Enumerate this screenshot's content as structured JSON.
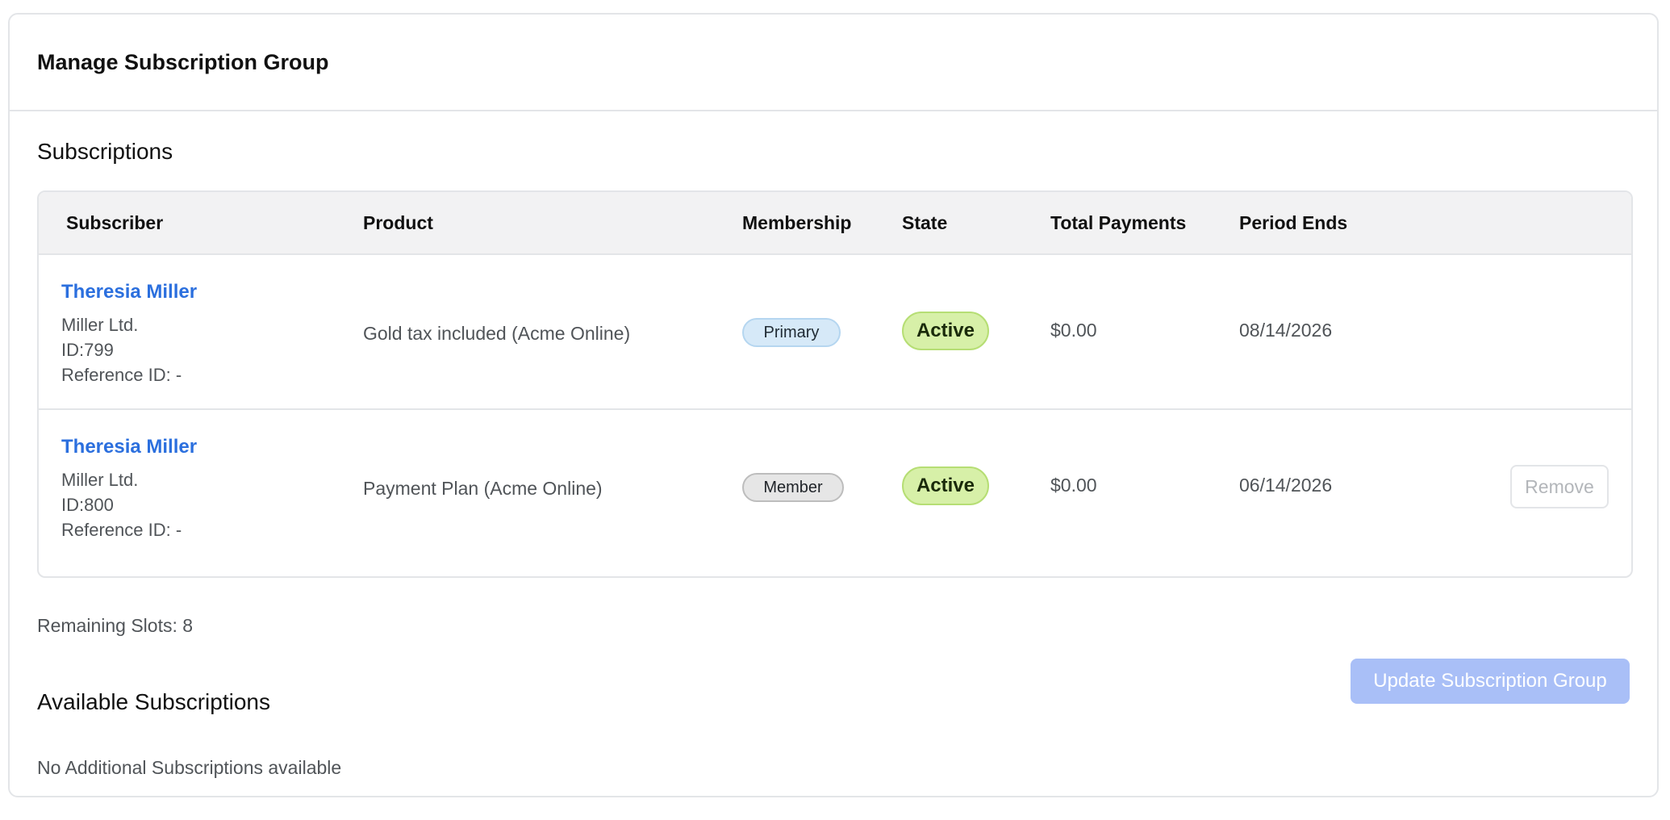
{
  "header": {
    "title": "Manage Subscription Group"
  },
  "subscriptions": {
    "title": "Subscriptions",
    "columns": {
      "subscriber": "Subscriber",
      "product": "Product",
      "membership": "Membership",
      "state": "State",
      "total_payments": "Total Payments",
      "period_ends": "Period Ends"
    },
    "rows": [
      {
        "name": "Theresia Miller",
        "company": "Miller Ltd.",
        "id": "ID:799",
        "reference": "Reference ID: -",
        "product": "Gold tax included (Acme Online)",
        "membership": "Primary",
        "state": "Active",
        "total_payments": "$0.00",
        "period_ends": "08/14/2026"
      },
      {
        "name": "Theresia Miller",
        "company": "Miller Ltd.",
        "id": "ID:800",
        "reference": "Reference ID: -",
        "product": "Payment Plan (Acme Online)",
        "membership": "Member",
        "state": "Active",
        "total_payments": "$0.00",
        "period_ends": "06/14/2026",
        "action": "Remove"
      }
    ]
  },
  "remaining": "Remaining Slots: 8",
  "update_button": "Update Subscription Group",
  "available": {
    "title": "Available Subscriptions",
    "empty_text": "No Additional Subscriptions available"
  },
  "colors": {
    "link": "#2b6fde",
    "active_badge": "#d7f0a8",
    "primary_badge": "#d6e9f8",
    "member_badge": "#e6e6e6",
    "update_button": "#a9bff7"
  }
}
